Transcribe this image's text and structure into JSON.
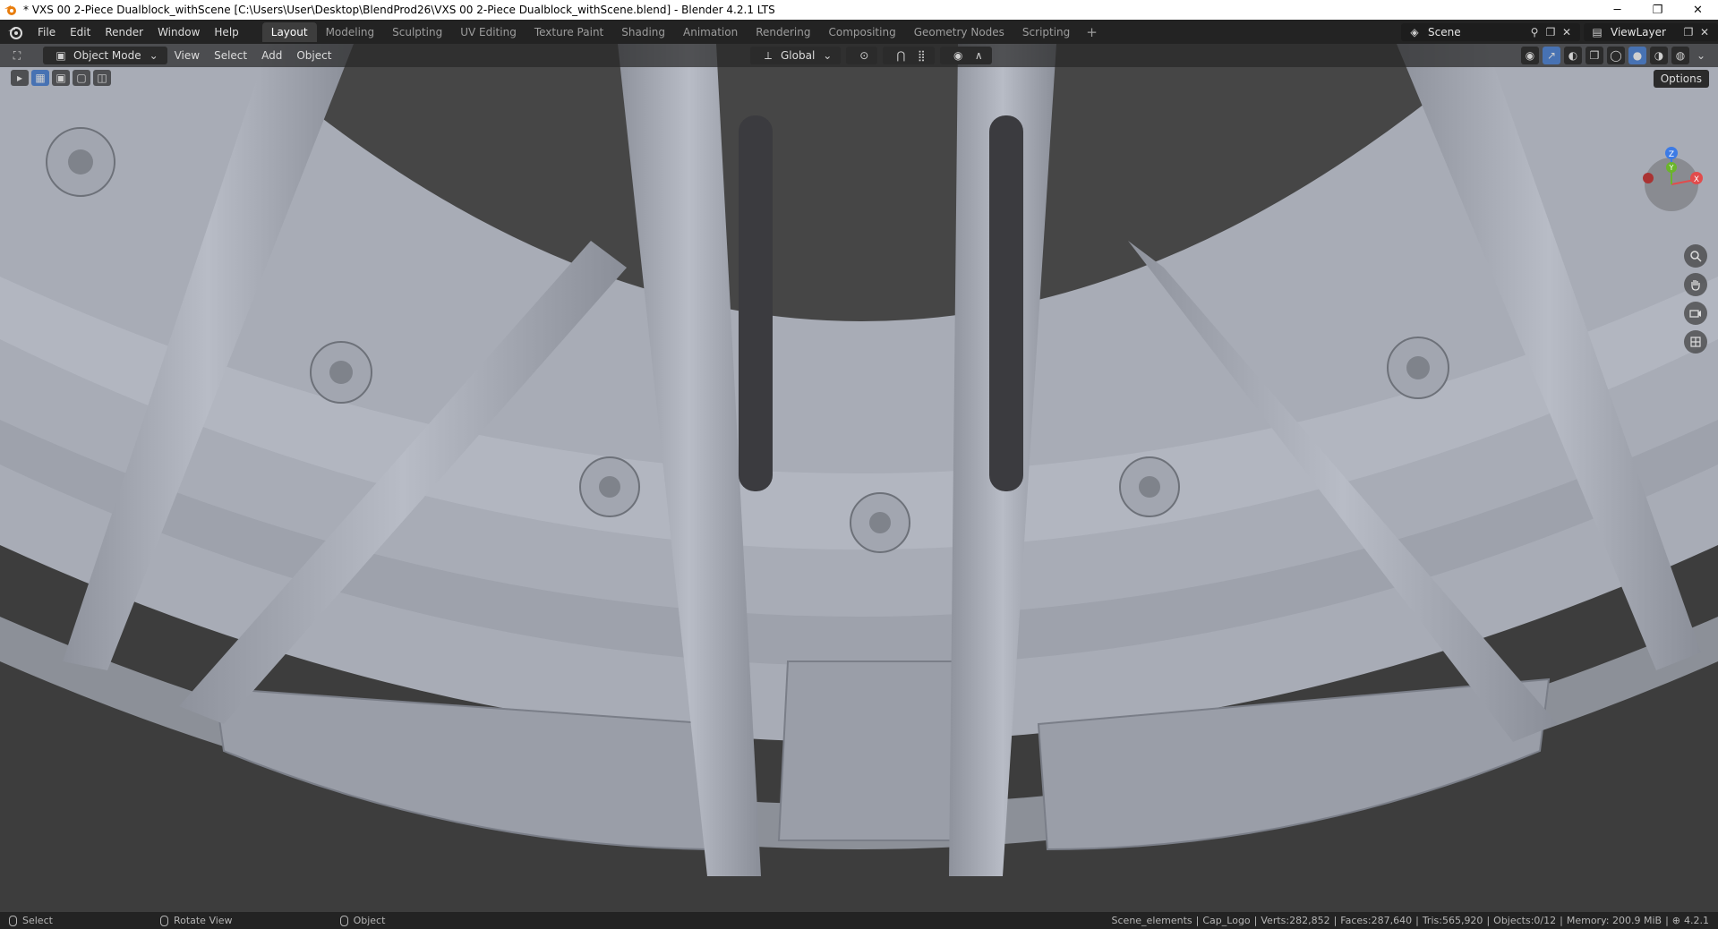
{
  "window": {
    "title": "* VXS 00 2-Piece Dualblock_withScene [C:\\Users\\User\\Desktop\\BlendProd26\\VXS 00 2-Piece Dualblock_withScene.blend] - Blender 4.2.1 LTS",
    "minimize": "─",
    "maximize": "❐",
    "close": "✕"
  },
  "topbar": {
    "menus": [
      "File",
      "Edit",
      "Render",
      "Window",
      "Help"
    ],
    "workspaces": [
      "Layout",
      "Modeling",
      "Sculpting",
      "UV Editing",
      "Texture Paint",
      "Shading",
      "Animation",
      "Rendering",
      "Compositing",
      "Geometry Nodes",
      "Scripting"
    ],
    "active_workspace": "Layout",
    "add_tab": "+",
    "scene": "Scene",
    "view_layer": "ViewLayer"
  },
  "header": {
    "mode": "Object Mode",
    "menus": [
      "View",
      "Select",
      "Add",
      "Object"
    ],
    "transform_orientation": "Global",
    "options": "Options"
  },
  "gizmo": {
    "z_label": "Z",
    "y_label": "Y",
    "x_label": "X"
  },
  "status": {
    "hint_select": "Select",
    "hint_rotate": "Rotate View",
    "hint_object": "Object",
    "collection": "Scene_elements",
    "active_object": "Cap_Logo",
    "verts": "Verts:282,852",
    "faces": "Faces:287,640",
    "tris": "Tris:565,920",
    "objects": "Objects:0/12",
    "memory": "Memory: 200.9 MiB",
    "version": "4.2.1",
    "sep": "|"
  },
  "colors": {
    "accent": "#4772b3",
    "x_axis": "#e24c4c",
    "y_axis": "#6bb52b",
    "z_axis": "#3d7be5"
  }
}
